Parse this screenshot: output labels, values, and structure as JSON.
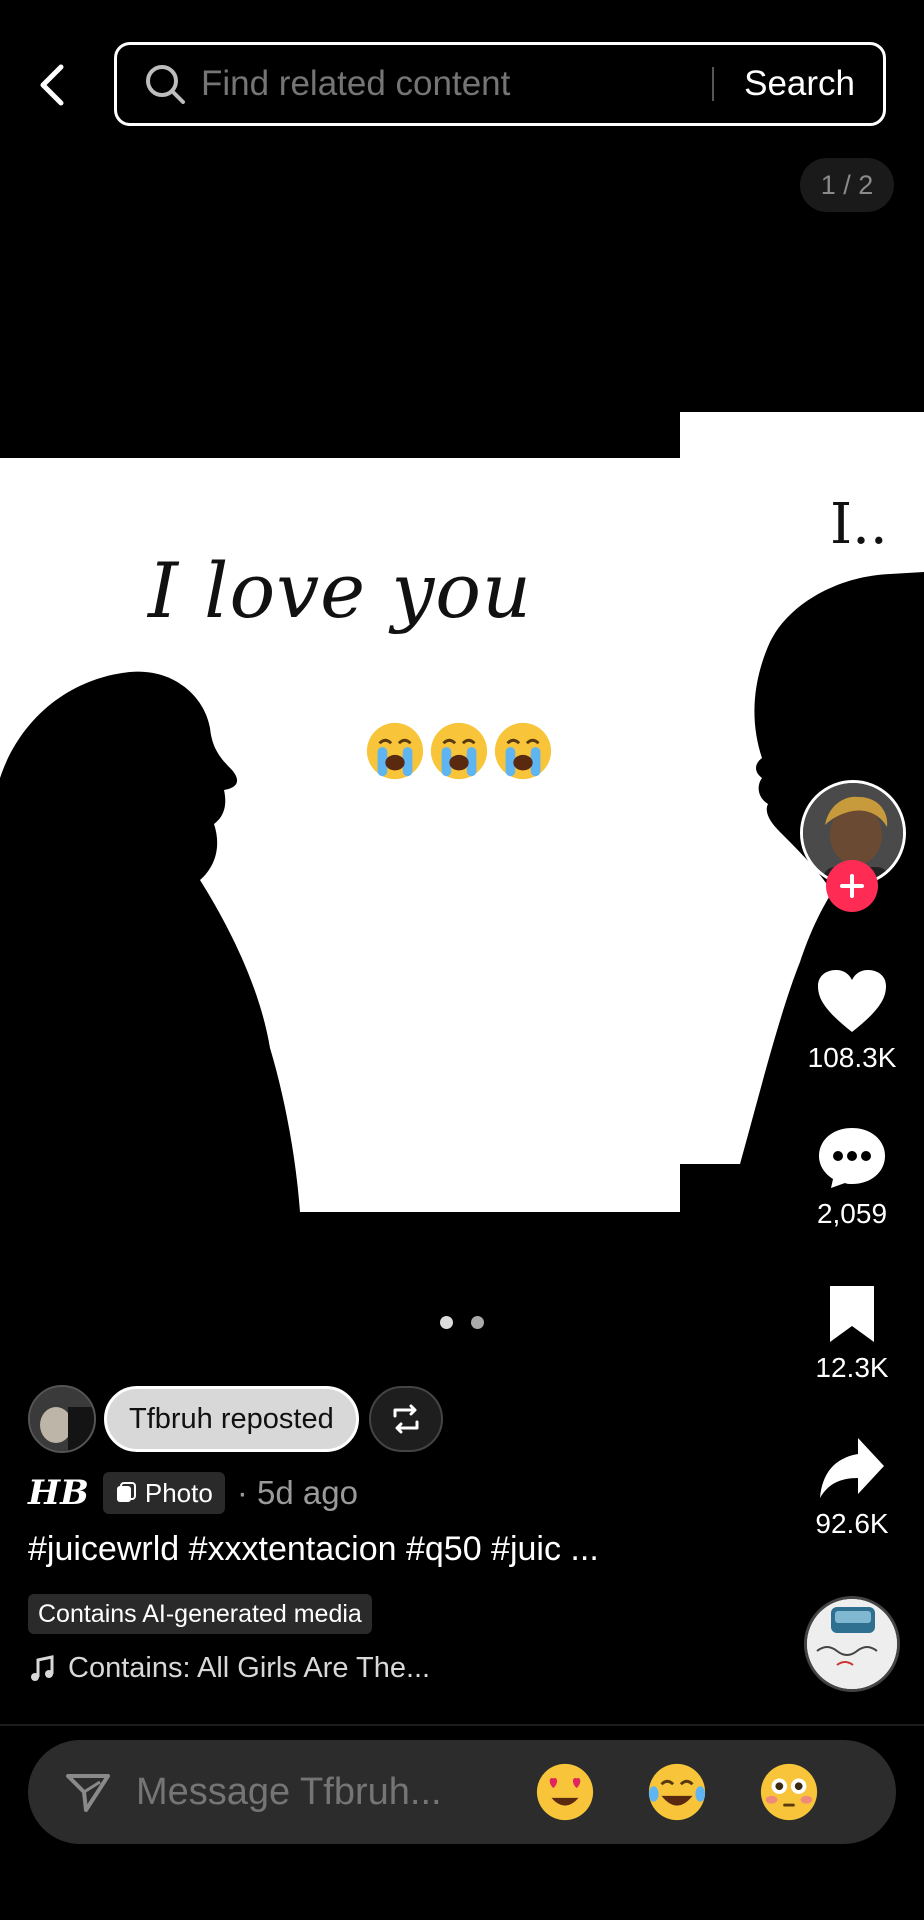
{
  "search": {
    "placeholder": "Find related content",
    "button_label": "Search"
  },
  "pager": {
    "label": "1 / 2"
  },
  "photo": {
    "overlay_text": "I love you",
    "overlay_emojis": "😭😭😭",
    "next_photo_text": "I.."
  },
  "carousel": {
    "total": 2,
    "current": 1
  },
  "actions": {
    "likes": "108.3K",
    "comments": "2,059",
    "saves": "12.3K",
    "shares": "92.6K"
  },
  "repost": {
    "label": "Tfbruh reposted"
  },
  "post": {
    "username": "HB",
    "type_badge": "Photo",
    "time": "· 5d ago",
    "caption": "#juicewrld #xxxtentacion #q50 #juic ...",
    "ai_label": "Contains AI-generated media",
    "music": "Contains: All Girls Are The..."
  },
  "message": {
    "placeholder": "Message Tfbruh...",
    "quick_emojis": [
      "😍",
      "😂",
      "😳"
    ]
  },
  "colors": {
    "background": "#000000",
    "accent": "#fe2c55"
  }
}
